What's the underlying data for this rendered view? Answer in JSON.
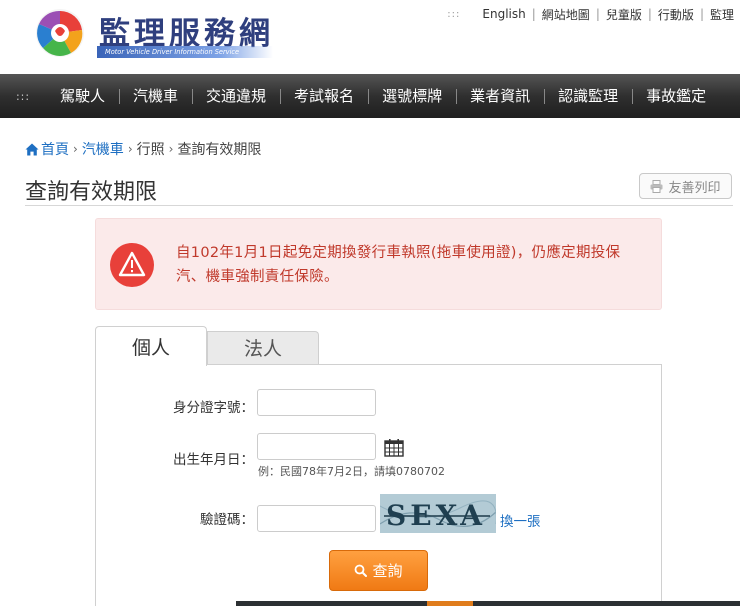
{
  "header": {
    "logo_title": "監理服務網",
    "logo_subtitle": "Motor Vehicle Driver Information Service",
    "toplinks": [
      "English",
      "網站地圖",
      "兒童版",
      "行動版",
      "監理"
    ]
  },
  "nav": {
    "items": [
      "駕駛人",
      "汽機車",
      "交通違規",
      "考試報名",
      "選號標牌",
      "業者資訊",
      "認識監理",
      "事故鑑定"
    ]
  },
  "breadcrumb": {
    "home": "首頁",
    "level1": "汽機車",
    "level2": "行照",
    "current": "查詢有效期限",
    "sep": "›"
  },
  "page": {
    "title": "查詢有效期限",
    "print_label": "友善列印"
  },
  "alert": {
    "text": "自102年1月1日起免定期換發行車執照(拖車使用證)，仍應定期投保汽、機車強制責任保險。"
  },
  "tabs": [
    "個人",
    "法人"
  ],
  "form": {
    "id_label": "身分證字號：",
    "id_value": "",
    "birth_label": "出生年月日：",
    "birth_value": "",
    "birth_hint": "例：民國78年7月2日，請填0780702",
    "captcha_label": "驗證碼：",
    "captcha_value": "",
    "captcha_text": "SEXA",
    "refresh_label": "換一張",
    "submit_label": "查詢"
  },
  "colors": {
    "nav_bg": "#2f2f2f",
    "link": "#1e6fc2",
    "alert_bg": "#fbeaea",
    "alert_text": "#c0392b",
    "button": "#f07a14"
  }
}
